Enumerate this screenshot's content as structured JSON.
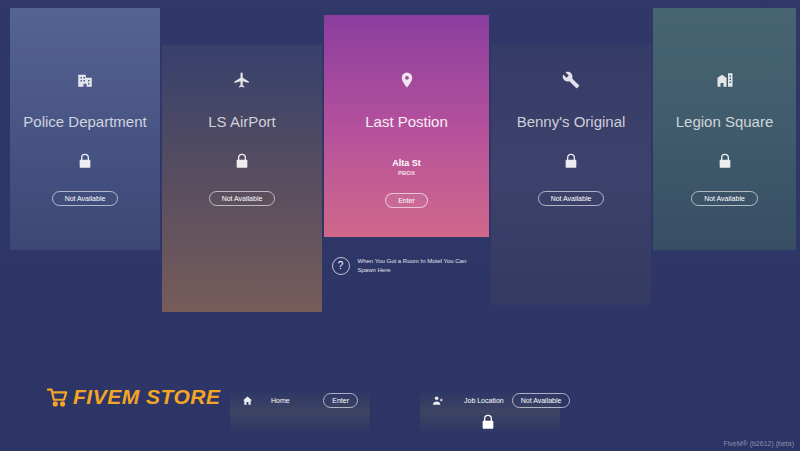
{
  "cards": [
    {
      "title": "Police Department",
      "locked": true,
      "button": "Not Available"
    },
    {
      "title": "LS AirPort",
      "locked": true,
      "button": "Not Available"
    },
    {
      "title": "Last Postion",
      "locked": false,
      "street": "Alta St",
      "zone": "PBOX",
      "button": "Enter"
    },
    {
      "title": "Benny's Original",
      "locked": true,
      "button": "Not Available"
    },
    {
      "title": "Legion Square",
      "locked": true,
      "button": "Not Available"
    }
  ],
  "hint": {
    "icon": "?",
    "text": "When You Got a Room In Motel You Can Spawn Here"
  },
  "logo": {
    "text": "FIVEM STORE"
  },
  "bottom": [
    {
      "label": "Home",
      "button": "Enter",
      "locked": false
    },
    {
      "label": "Job Location",
      "button": "Not Available",
      "locked": true
    }
  ],
  "footer": "FiveM® (b2612) (beta)"
}
